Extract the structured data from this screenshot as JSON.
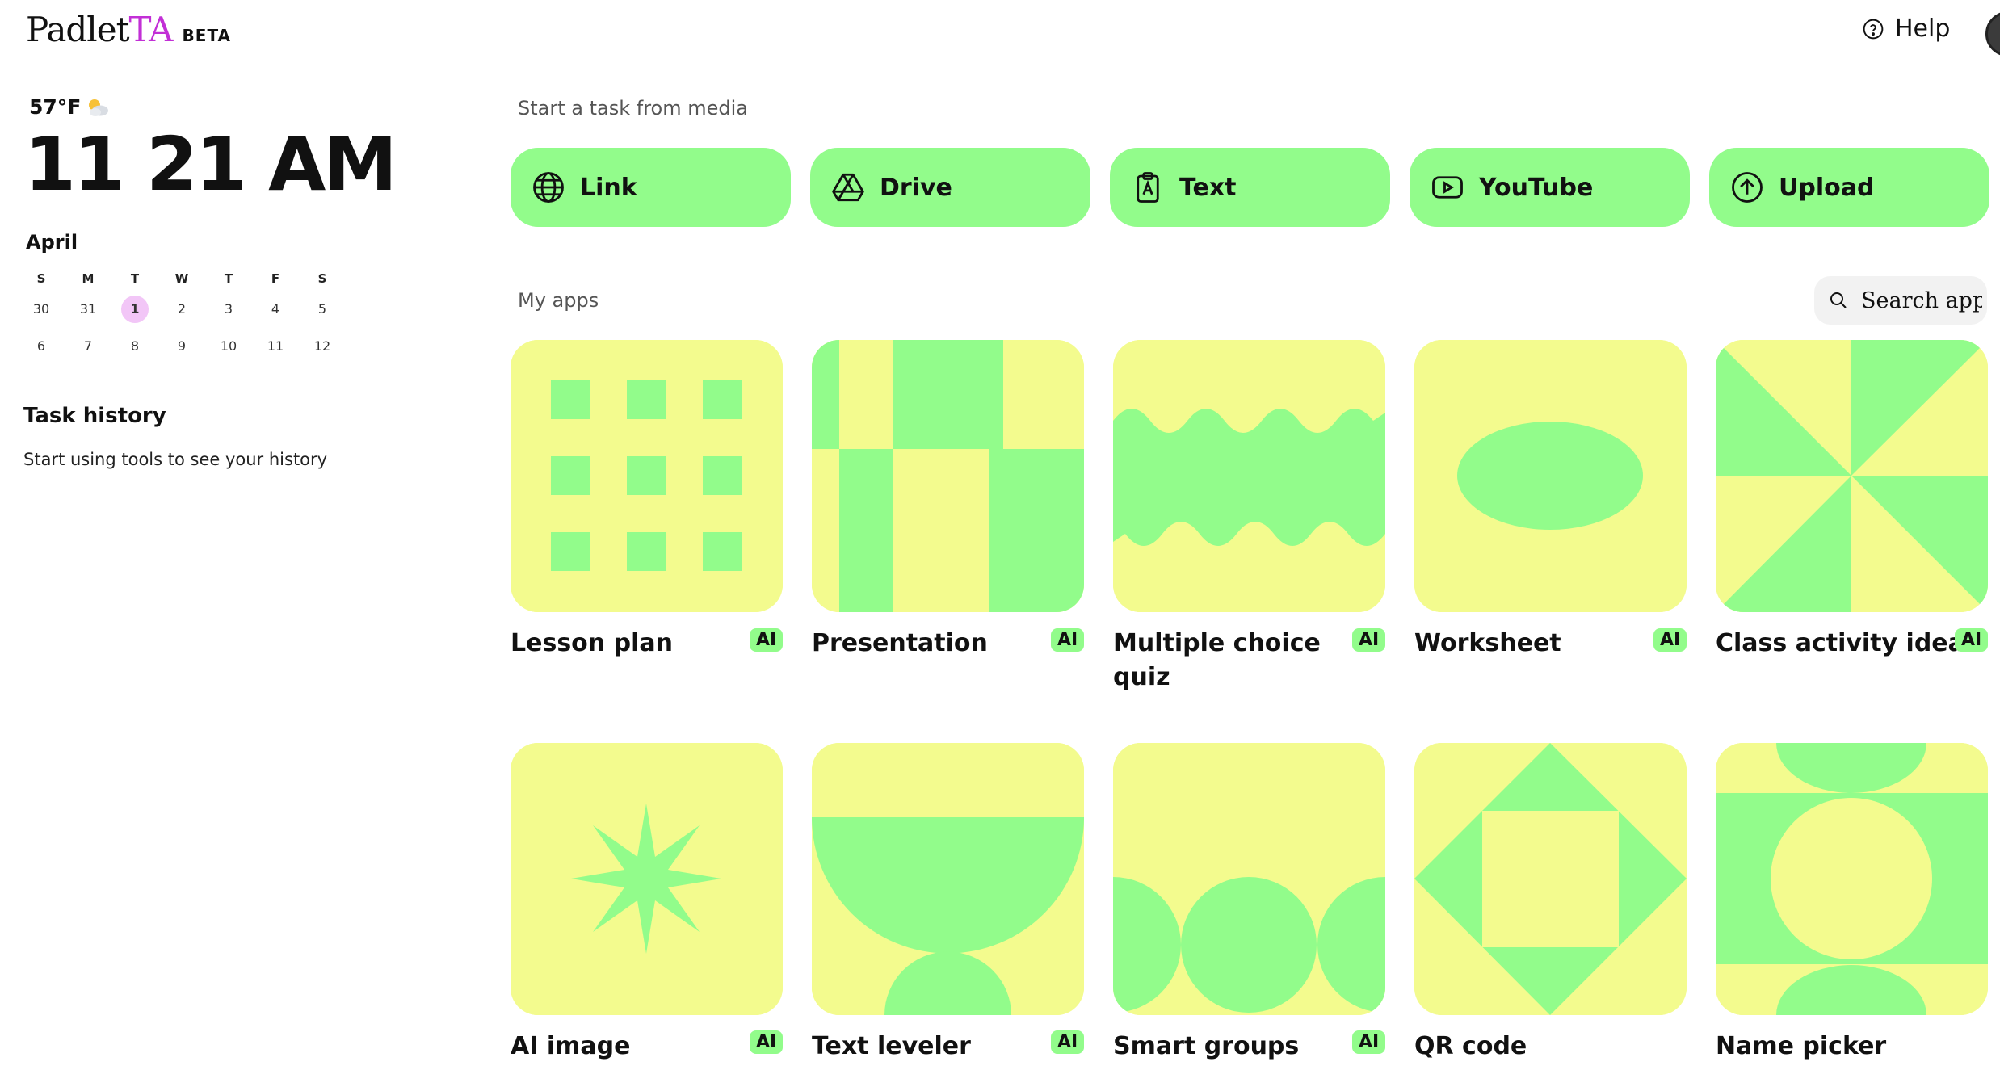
{
  "header": {
    "brand_main": "Padlet",
    "brand_accent": "TA",
    "beta": "BETA",
    "help_label": "Help"
  },
  "sidebar": {
    "weather": "57°F",
    "weather_icon": "partly-cloudy-icon",
    "time": "11 21 AM",
    "month": "April",
    "weekdays": [
      "S",
      "M",
      "T",
      "W",
      "T",
      "F",
      "S"
    ],
    "days": [
      "30",
      "31",
      "1",
      "2",
      "3",
      "4",
      "5",
      "6",
      "7",
      "8",
      "9",
      "10",
      "11",
      "12"
    ],
    "today": "1",
    "task_history_title": "Task history",
    "task_history_empty": "Start using tools to see your history"
  },
  "media": {
    "label": "Start a task from media",
    "buttons": [
      {
        "label": "Link",
        "icon": "globe-icon"
      },
      {
        "label": "Drive",
        "icon": "google-drive-icon"
      },
      {
        "label": "Text",
        "icon": "clipboard-text-icon"
      },
      {
        "label": "YouTube",
        "icon": "youtube-icon"
      },
      {
        "label": "Upload",
        "icon": "upload-icon"
      }
    ]
  },
  "apps": {
    "label": "My apps",
    "search_placeholder": "Search apps",
    "ai_badge": "AI",
    "items": [
      {
        "name": "Lesson plan",
        "ai": true
      },
      {
        "name": "Presentation",
        "ai": true
      },
      {
        "name": "Multiple choice quiz",
        "ai": true
      },
      {
        "name": "Worksheet",
        "ai": true
      },
      {
        "name": "Class activity ideas",
        "ai": true
      },
      {
        "name": "AI image",
        "ai": true
      },
      {
        "name": "Text leveler",
        "ai": true
      },
      {
        "name": "Smart groups",
        "ai": true
      },
      {
        "name": "QR code",
        "ai": false
      },
      {
        "name": "Name picker",
        "ai": false
      }
    ]
  },
  "colors": {
    "accent_green": "#92fc8b",
    "tile_yellow": "#f3fb8e",
    "brand_purple": "#c22fd6",
    "today_pink": "#f2c6f7"
  }
}
